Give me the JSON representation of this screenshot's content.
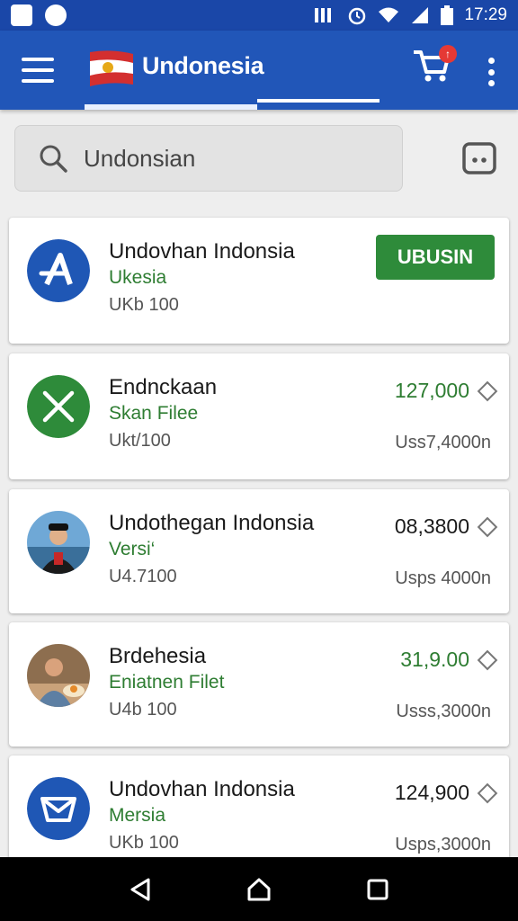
{
  "status_bar": {
    "time": "17:29"
  },
  "app_bar": {
    "title": "Undonesia",
    "cart_badge": "↑",
    "flag_icon": "flag-icon",
    "colors": {
      "primary": "#2156b8",
      "status": "#1a47a8"
    }
  },
  "search": {
    "value": "Undonsian"
  },
  "items": [
    {
      "name": "Undovhan Indonsia",
      "subtitle": "Ukesia",
      "meta": "UKb 100",
      "action": "UBUSIN",
      "avatar_icon": "a-logo-icon"
    },
    {
      "name": "Endnckaan",
      "subtitle": "Skan Filee",
      "meta": "Ukt/100",
      "price": "127,000",
      "right_meta": "Uss7,4000n",
      "avatar_icon": "x-circle-icon"
    },
    {
      "name": "Undothegan Indonsia",
      "subtitle": "Versi‘",
      "meta": "U4.7100",
      "price": "08,3800",
      "right_meta": "Usps 4000n",
      "avatar_icon": "person-photo-icon"
    },
    {
      "name": "Brdehesia",
      "subtitle": "Eniatnen Filet",
      "meta": "U4b 100",
      "price": "31,9.00",
      "right_meta": "Usss,3000n",
      "avatar_icon": "person-food-photo-icon"
    },
    {
      "name": "Undovhan Indonsia",
      "subtitle": "Mersia",
      "meta": "UKb 100",
      "price": "124,900",
      "right_meta": "Usps,3000n",
      "avatar_icon": "envelope-logo-icon"
    }
  ],
  "accent_green": "#2e7d32"
}
